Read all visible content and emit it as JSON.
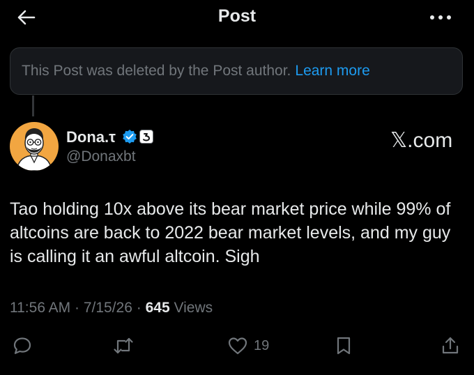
{
  "header": {
    "title": "Post",
    "back_icon": "arrow-left-icon",
    "more_icon": "ellipsis-icon"
  },
  "deleted_notice": {
    "text": "This Post was deleted by the Post author.",
    "link": "Learn more"
  },
  "author": {
    "name": "Dona.τ",
    "handle": "@Donaxbt",
    "verified": true
  },
  "watermark": "𝕏.com",
  "post": {
    "text": "Tao holding 10x above its bear market price while 99% of altcoins are back to 2022 bear market levels, and my guy is calling it an awful altcoin. Sigh"
  },
  "meta": {
    "time": "11:56 AM",
    "date": "7/15/26",
    "views_count": "645",
    "views_label": "Views"
  },
  "actions": {
    "like_count": "19"
  },
  "colors": {
    "background": "#000000",
    "text": "#e7e9ea",
    "muted": "#71767b",
    "link": "#1d9bf0",
    "verified": "#1d9bf0",
    "avatar_bg": "#f2a641"
  }
}
